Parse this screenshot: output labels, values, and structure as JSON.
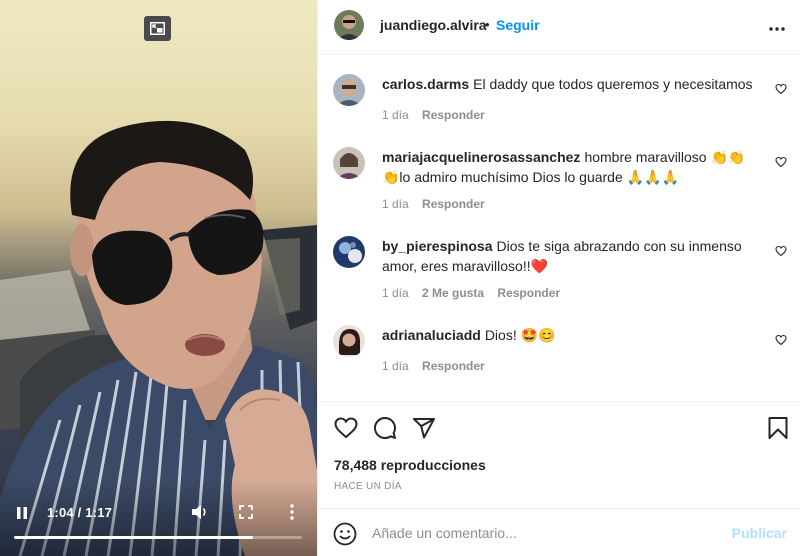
{
  "video": {
    "time_display": "1:04 / 1:17",
    "progress": 0.83
  },
  "post": {
    "username": "juandiego.alvira",
    "separator": "•",
    "follow_label": "Seguir",
    "more_label": "•••"
  },
  "comments": [
    {
      "username": "carlos.darms",
      "text": "El daddy que todos queremos y necesitamos",
      "time": "1 día",
      "likes": "",
      "reply": "Responder"
    },
    {
      "username": "mariajacquelinerosassanchez",
      "text": "hombre maravilloso 👏👏👏lo admiro muchísimo Dios lo guarde 🙏🙏🙏",
      "time": "1 día",
      "likes": "",
      "reply": "Responder"
    },
    {
      "username": "by_pierespinosa",
      "text": "Dios te siga abrazando con su inmenso amor, eres maravilloso!!❤️",
      "time": "1 día",
      "likes": "2 Me gusta",
      "reply": "Responder"
    },
    {
      "username": "adrianaluciadd",
      "text": "Dios! 🤩😊",
      "time": "1 día",
      "likes": "",
      "reply": "Responder"
    }
  ],
  "stats": {
    "views": "78,488 reproducciones",
    "posted": "HACE UN DÍA"
  },
  "add_comment": {
    "placeholder": "Añade un comentario...",
    "publish_label": "Publicar"
  },
  "colors": {
    "accent": "#0095f6",
    "publish_disabled": "#b2dffc",
    "muted": "#8e8e8e",
    "heart_red": "#ed4956"
  }
}
